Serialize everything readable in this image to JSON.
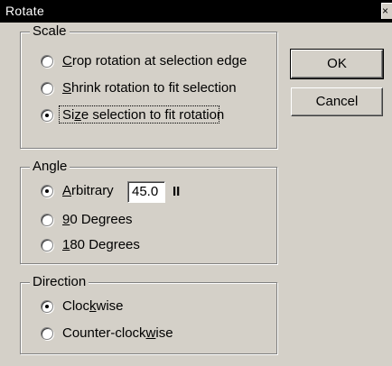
{
  "window": {
    "title": "Rotate",
    "close_glyph": "×"
  },
  "scale": {
    "legend": "Scale",
    "options": [
      {
        "label": "Crop rotation at selection edge",
        "mnemonic": "C",
        "selected": false
      },
      {
        "label": "Shrink rotation to fit selection",
        "mnemonic": "S",
        "selected": false
      },
      {
        "label": "Size selection to fit rotation",
        "mnemonic": "z",
        "selected": true
      }
    ]
  },
  "angle": {
    "legend": "Angle",
    "arbitrary_label": "Arbitrary",
    "arbitrary_value": "45.0",
    "arbitrary_unit": "II",
    "options": [
      {
        "label": "Arbitrary",
        "mnemonic": "A",
        "selected": true
      },
      {
        "label": "90 Degrees",
        "mnemonic": "9",
        "selected": false
      },
      {
        "label": "180 Degrees",
        "mnemonic": "1",
        "selected": false
      }
    ]
  },
  "direction": {
    "legend": "Direction",
    "options": [
      {
        "label": "Clockwise",
        "mnemonic": "k",
        "selected": true
      },
      {
        "label": "Counter-clockwise",
        "mnemonic": "w",
        "selected": false
      }
    ]
  },
  "buttons": {
    "ok": "OK",
    "cancel": "Cancel"
  }
}
